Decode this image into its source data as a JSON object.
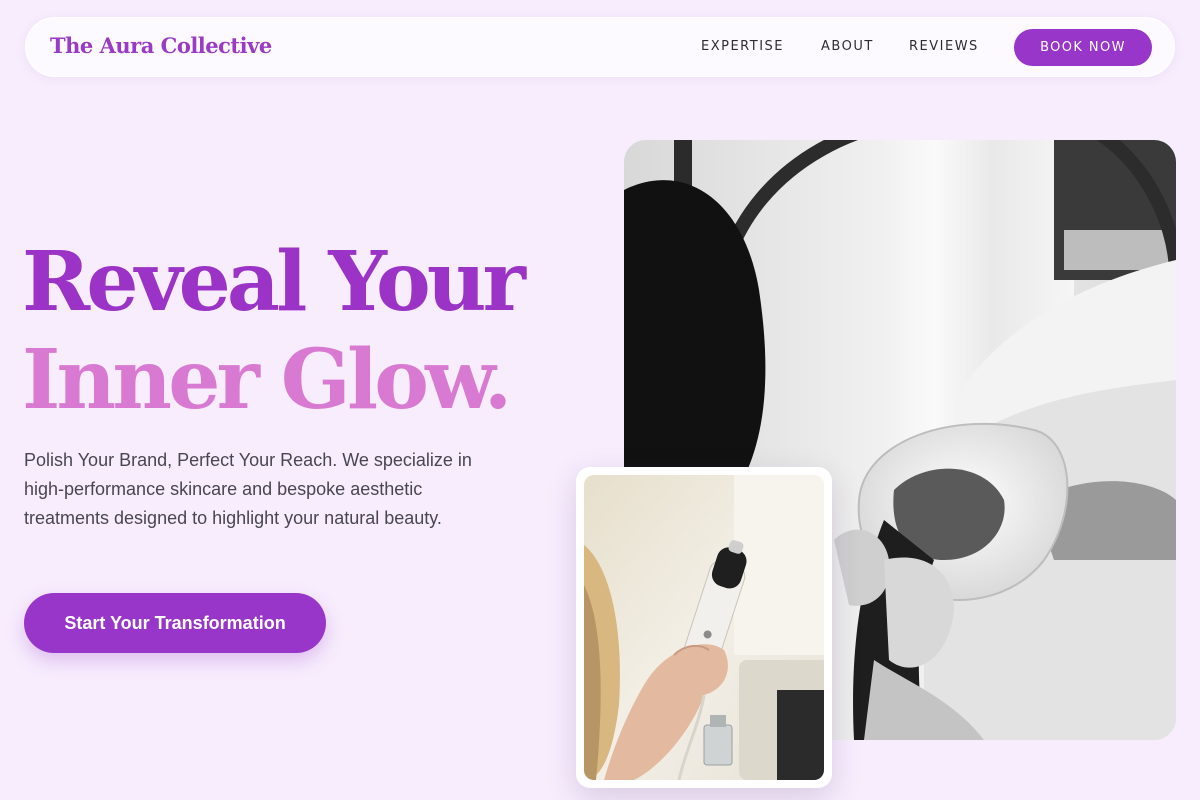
{
  "nav": {
    "brand": "The Aura Collective",
    "links": [
      "EXPERTISE",
      "ABOUT",
      "REVIEWS"
    ],
    "book_label": "BOOK NOW"
  },
  "hero": {
    "headline_line1": "Reveal Your",
    "headline_line2": "Inner Glow.",
    "description": "Polish Your Brand, Perfect Your Reach. We specialize in high-performance skincare and bespoke aesthetic treatments designed to highlight your natural beauty.",
    "cta_label": "Start Your Transformation"
  },
  "colors": {
    "accent": "#9736c9",
    "headline_primary": "#9b34c6",
    "headline_secondary": "#d97ad2",
    "background": "#f7edfd"
  },
  "images": {
    "main": "led-light-therapy-facial-photo",
    "secondary": "handheld-skincare-device-photo"
  }
}
